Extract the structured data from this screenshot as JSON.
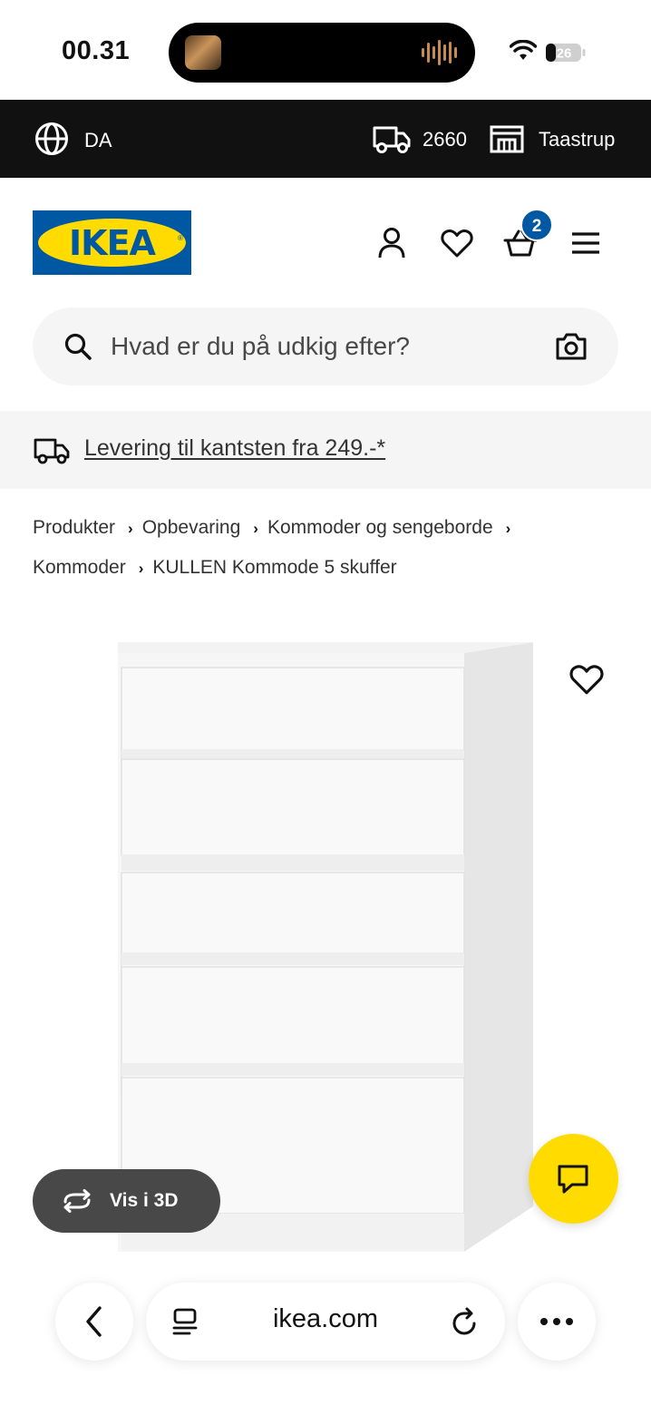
{
  "status_bar": {
    "time": "00.31",
    "battery_level": "26"
  },
  "topbar": {
    "language": "DA",
    "postal_code": "2660",
    "store": "Taastrup"
  },
  "header": {
    "logo_text": "IKEA",
    "cart_count": "2",
    "icons": [
      "account-icon",
      "heart-icon",
      "cart-icon",
      "menu-icon"
    ]
  },
  "search": {
    "placeholder": "Hvad er du på udkig efter?"
  },
  "delivery_banner": {
    "text": "Levering til kantsten fra 249.-*"
  },
  "breadcrumb": {
    "items": [
      "Produkter",
      "Opbevaring",
      "Kommoder og sengeborde",
      "Kommoder",
      "KULLEN Kommode 5 skuffer"
    ]
  },
  "product": {
    "view_3d_label": "Vis i 3D"
  },
  "browser": {
    "url": "ikea.com"
  },
  "colors": {
    "ikea_blue": "#0058a3",
    "ikea_yellow": "#ffdb00",
    "topbar_bg": "#111111"
  }
}
